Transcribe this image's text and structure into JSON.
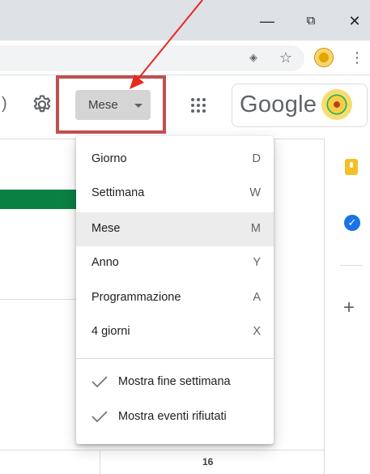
{
  "browser": {
    "minimize_glyph": "—",
    "restore_glyph": "⧉",
    "close_glyph": "✕",
    "bookmark_glyph": "☆",
    "menu_glyph": "⋮",
    "extension_glyph": "◈"
  },
  "header": {
    "paren_glyph": ")",
    "view_button_label": "Mese",
    "google_label": "Google"
  },
  "menu": {
    "items": [
      {
        "label": "Giorno",
        "key": "D"
      },
      {
        "label": "Settimana",
        "key": "W"
      },
      {
        "label": "Mese",
        "key": "M",
        "selected": true
      },
      {
        "label": "Anno",
        "key": "Y"
      },
      {
        "label": "Programmazione",
        "key": "A"
      },
      {
        "label": "4 giorni",
        "key": "X"
      }
    ],
    "options": [
      {
        "label": "Mostra fine settimana",
        "checked": true
      },
      {
        "label": "Mostra eventi rifiutati",
        "checked": true
      }
    ]
  },
  "calendar": {
    "day_number": "16"
  },
  "side_panel": {
    "tasks_glyph": "✓",
    "add_glyph": "+"
  },
  "colors": {
    "event_green": "#0b8043",
    "highlight_red": "#c0504d",
    "arrow_red": "#e8271d",
    "keep_yellow": "#f6bf26",
    "tasks_blue": "#1a73e8"
  }
}
